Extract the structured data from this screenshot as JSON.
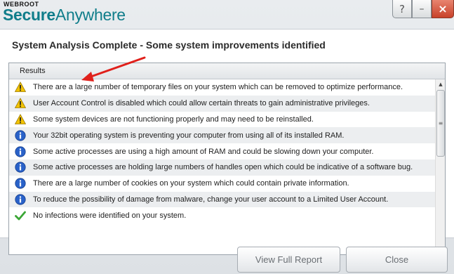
{
  "app": {
    "logo_small": "WEBROOT",
    "logo_secure": "Secure",
    "logo_anywhere": "Anywhere"
  },
  "window_controls": {
    "help": "?",
    "minimize": "–",
    "close": "×"
  },
  "heading": "System Analysis Complete - Some system improvements identified",
  "results": {
    "header": "Results",
    "items": [
      {
        "icon": "warning-icon",
        "text": "There are a large number of temporary files on your system which can be removed to optimize performance."
      },
      {
        "icon": "warning-icon",
        "text": "User Account Control is disabled which could allow certain threats to gain administrative privileges."
      },
      {
        "icon": "warning-icon",
        "text": "Some system devices are not functioning properly and may need to be reinstalled."
      },
      {
        "icon": "info-icon",
        "text": "Your 32bit operating system is preventing your computer from using all of its installed RAM."
      },
      {
        "icon": "info-icon",
        "text": "Some active processes are using a high amount of RAM and could be slowing down your computer."
      },
      {
        "icon": "info-icon",
        "text": "Some active processes are holding large numbers of handles open which could be indicative of a software bug."
      },
      {
        "icon": "info-icon",
        "text": "There are a large number of cookies on your system which could contain private information."
      },
      {
        "icon": "info-icon",
        "text": "To reduce the possibility of damage from malware, change your user account to a Limited User Account."
      },
      {
        "icon": "checkmark-icon",
        "text": "No infections were identified on your system."
      }
    ]
  },
  "buttons": {
    "view_full_report": "View Full Report",
    "close": "Close"
  },
  "colors": {
    "brand": "#0f7d8a",
    "warning": "#f2c200",
    "info": "#2a62c9",
    "success": "#3aa635",
    "annotation": "#e0201b"
  }
}
